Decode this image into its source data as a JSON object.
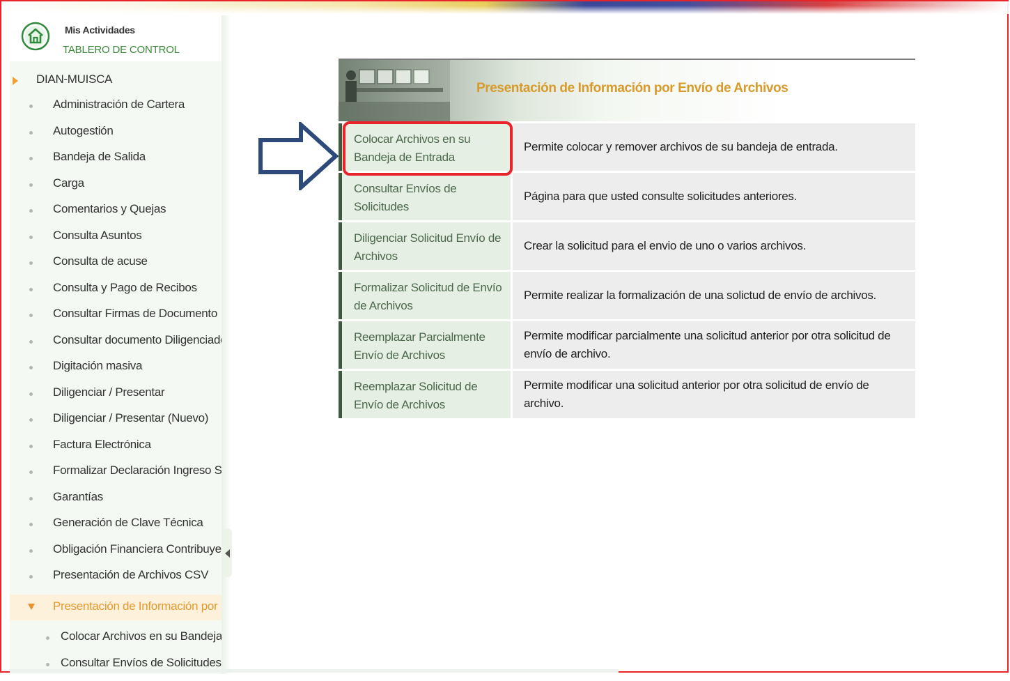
{
  "brand": {
    "title": "Mis Actividades",
    "subtitle": "TABLERO DE CONTROL",
    "icon": "home-icon"
  },
  "sidebar": {
    "root_label": "DIAN-MUISCA",
    "items": [
      {
        "label": "Administración de Cartera"
      },
      {
        "label": "Autogestión"
      },
      {
        "label": "Bandeja de Salida"
      },
      {
        "label": "Carga"
      },
      {
        "label": "Comentarios y Quejas"
      },
      {
        "label": "Consulta Asuntos"
      },
      {
        "label": "Consulta de acuse"
      },
      {
        "label": "Consulta y Pago de Recibos"
      },
      {
        "label": "Consultar Firmas de Documento"
      },
      {
        "label": "Consultar documento Diligenciado"
      },
      {
        "label": "Digitación masiva"
      },
      {
        "label": "Diligenciar / Presentar"
      },
      {
        "label": "Diligenciar / Presentar (Nuevo)"
      },
      {
        "label": "Factura Electrónica"
      },
      {
        "label": "Formalizar Declaración Ingreso S"
      },
      {
        "label": "Garantías"
      },
      {
        "label": "Generación de Clave Técnica"
      },
      {
        "label": "Obligación Financiera Contribuyente"
      },
      {
        "label": "Presentación de Archivos CSV"
      }
    ],
    "active_item": "Presentación de Información por",
    "subitems": [
      {
        "label": "Colocar Archivos en su Bandeja"
      },
      {
        "label": "Consultar Envíos de Solicitudes"
      }
    ]
  },
  "panel": {
    "title": "Presentación de Información por Envío de Archivos",
    "rows": [
      {
        "link": "Colocar Archivos en su Bandeja de Entrada",
        "desc": "Permite colocar y remover archivos de su bandeja de entrada."
      },
      {
        "link": "Consultar Envíos de Solicitudes",
        "desc": "Página para que usted consulte solicitudes anteriores."
      },
      {
        "link": "Diligenciar Solicitud Envío de Archivos",
        "desc": "Crear la solicitud para el envio de uno o varios archivos."
      },
      {
        "link": "Formalizar Solicitud de Envío de Archivos",
        "desc": "Permite realizar la formalización de una solictud de envío de archivos."
      },
      {
        "link": "Reemplazar Parcialmente Envío de Archivos",
        "desc": "Permite modificar parcialmente una solicitud anterior por otra solicitud de envío de archivo."
      },
      {
        "link": "Reemplazar Solicitud de Envío de Archivos",
        "desc": "Permite modificar una solicitud anterior por otra solicitud de envío de archivo."
      }
    ]
  },
  "colors": {
    "accent_orange": "#e59a2e",
    "highlight_red": "#e8232a",
    "arrow_blue": "#2e4a7a",
    "link_green": "#4a6a4a"
  }
}
